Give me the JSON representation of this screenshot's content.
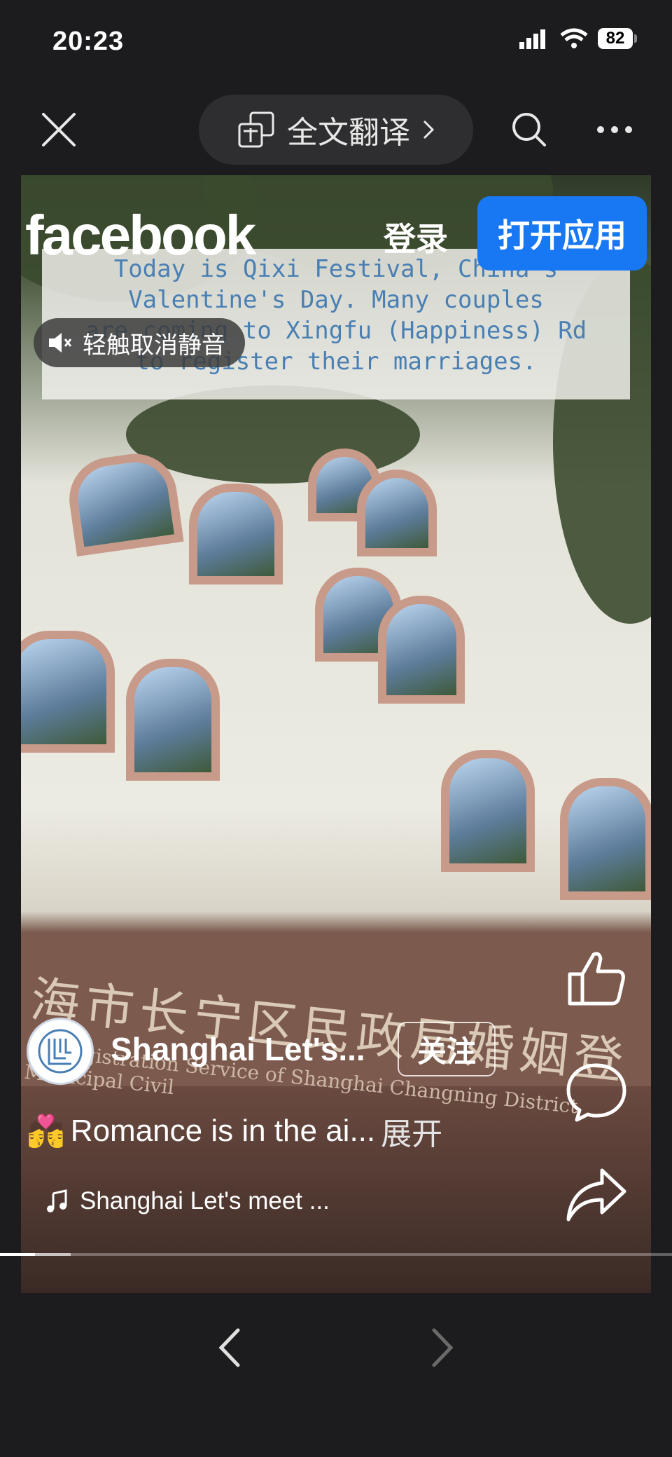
{
  "status_bar": {
    "time": "20:23",
    "battery": "82"
  },
  "nav": {
    "translate_label": "全文翻译"
  },
  "video": {
    "caption_text": "Today is Qixi Festival, China's\nValentine's Day. Many couples\nare coming to Xingfu (Happiness) Rd\nto register their marriages.",
    "sign_cn": "海市长宁区民政局婚姻登",
    "sign_en": "ge Registration Service of Shanghai Changning District Municipal Civil"
  },
  "overlay": {
    "logo": "facebook",
    "login_label": "登录",
    "open_app_label": "打开应用",
    "mute_label": "轻触取消静音"
  },
  "post": {
    "page_name": "Shanghai Let's...",
    "follow_label": "关注",
    "emoji": "💏",
    "caption": "Romance is in the ai...",
    "expand_label": "展开",
    "music": "Shanghai Let's meet ..."
  },
  "progress": {
    "played_fraction": 0.052,
    "buffered_fraction": 0.105
  },
  "colors": {
    "accent": "#1877f2",
    "background": "#1c1c1e"
  },
  "icons": [
    "close-icon",
    "translate-icon",
    "chevron-right-icon",
    "search-icon",
    "more-icon",
    "mute-icon",
    "like-icon",
    "comment-icon",
    "share-icon",
    "music-note-icon",
    "back-arrow-icon",
    "forward-arrow-icon"
  ]
}
